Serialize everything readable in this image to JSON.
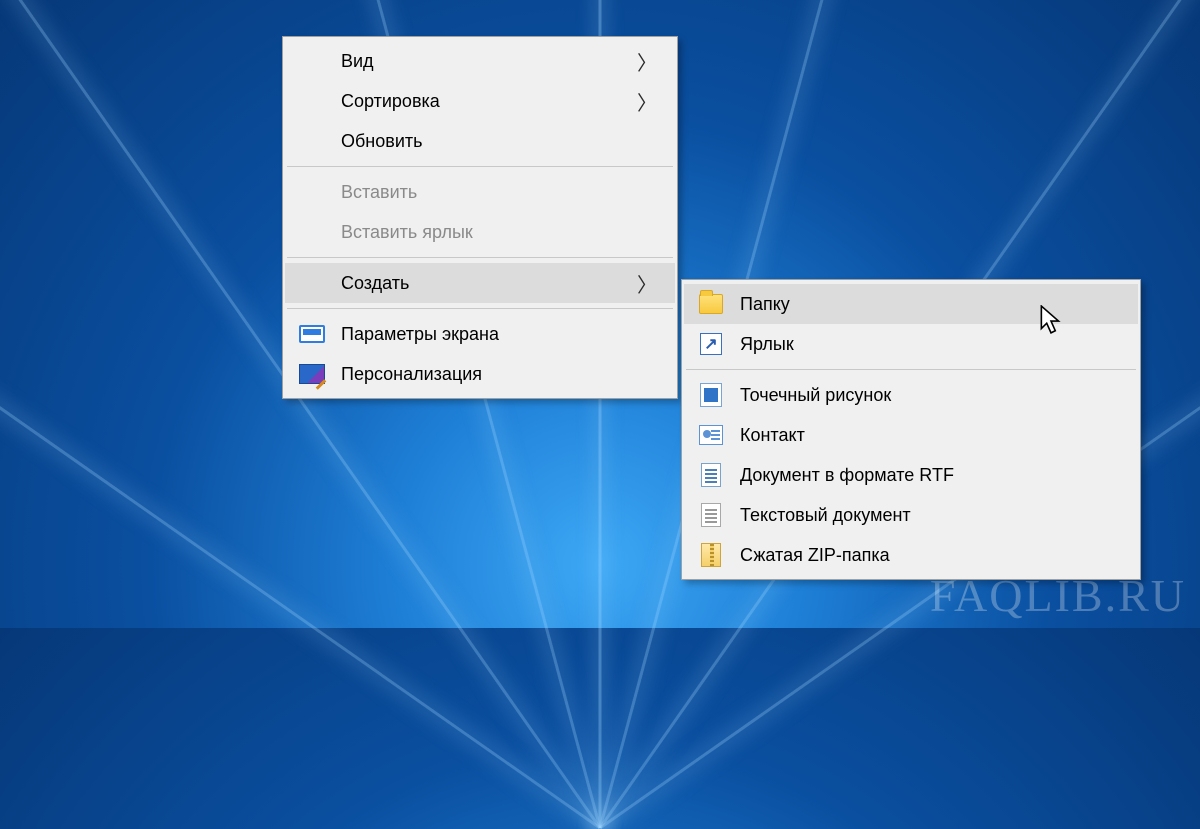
{
  "watermark": "FAQLIB.RU",
  "main_menu": {
    "view": "Вид",
    "sort": "Сортировка",
    "refresh": "Обновить",
    "paste": "Вставить",
    "paste_shortcut": "Вставить ярлык",
    "new": "Создать",
    "display_settings": "Параметры экрана",
    "personalize": "Персонализация"
  },
  "submenu": {
    "folder": "Папку",
    "shortcut": "Ярлык",
    "bitmap": "Точечный рисунок",
    "contact": "Контакт",
    "rtf": "Документ в формате RTF",
    "text": "Текстовый документ",
    "zip": "Сжатая ZIP-папка"
  }
}
